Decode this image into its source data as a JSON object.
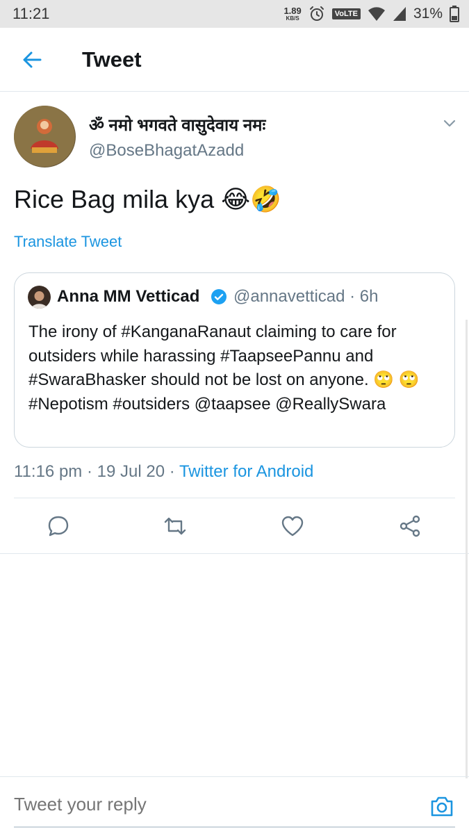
{
  "status_bar": {
    "time": "11:21",
    "net_speed": "1.89",
    "net_unit": "KB/S",
    "volte": "VoLTE",
    "battery": "31%"
  },
  "header": {
    "title": "Tweet"
  },
  "tweet": {
    "display_name": "ॐ नमो भगवते वासुदेवाय नमः",
    "handle": "@BoseBhagatAzadd",
    "text": "Rice Bag mila kya 😂🤣",
    "translate_label": "Translate Tweet",
    "time": "11:16 pm",
    "date": "19 Jul 20",
    "source": "Twitter for Android"
  },
  "quoted_tweet": {
    "display_name": "Anna MM Vetticad",
    "handle": "@annavetticad · 6h",
    "text": "The irony of #KanganaRanaut claiming to care for outsiders while harassing #TaapseePannu and #SwaraBhasker should not be lost on anyone. 🙄 🙄 #Nepotism #outsiders @taapsee @ReallySwara"
  },
  "reply": {
    "placeholder": "Tweet your reply"
  },
  "colors": {
    "accent": "#1b95e0",
    "secondary_text": "#657786",
    "divider": "#e1e8ed"
  }
}
